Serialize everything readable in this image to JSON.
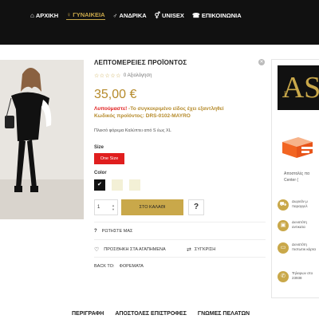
{
  "nav": {
    "items": [
      {
        "icon": "home-icon",
        "glyph": "⌂",
        "label": "ΑΡΧΙΚΗ",
        "active": false
      },
      {
        "icon": "female-icon",
        "glyph": "♀",
        "label": "ΓΥΝΑΙΚΕΙΑ",
        "active": true
      },
      {
        "icon": "male-icon",
        "glyph": "♂",
        "label": "ΑΝΔΡΙΚΑ",
        "active": false
      },
      {
        "icon": "unisex-icon",
        "glyph": "⚥",
        "label": "UNISEX",
        "active": false
      },
      {
        "icon": "contact-icon",
        "glyph": "☎",
        "label": "ΕΠΙΚΟΙΝΩΝΙΑ",
        "active": false
      }
    ]
  },
  "product": {
    "title": "ΛΕΠΤΟΜΕΡΕΙΕΣ ΠΡΟΪΟΝΤΟΣ",
    "stars": "☆☆☆☆☆",
    "rating_text": "0 Αξιολόγηση",
    "price": "35,00 €",
    "soldout_prefix": "Λυπούμαστε!",
    "soldout_text": " -Το συγκεκριμένο είδος έχει εξαντληθεί",
    "code_text": "Κωδικός προϊόντος: DRS-0102-MAYRO",
    "description": "Πλεκτό φόρεμα Καλύπτει από S έως XL",
    "size_label": "Size",
    "size_value": "One Size",
    "color_label": "Color",
    "qty_value": "1",
    "qty_up": "▲",
    "qty_down": "▼",
    "cart_label": "ΣΤΟ ΚΑΛΑΘΙ",
    "help_label": "?",
    "ask_label": "ΡΩΤΗΣΤΕ ΜΑΣ",
    "ask_glyph": "?",
    "wishlist_label": "ΠΡΟΣΘΗΚΗ ΣΤΑ ΑΓΑΠΗΜΕΝΑ",
    "wishlist_glyph": "♡",
    "compare_label": "ΣΥΓΚΡΙΣΗ",
    "compare_glyph": "⇄",
    "back_label": "BACK TO:",
    "back_link": "ΦΟΡΕΜΑΤΑ"
  },
  "tabs": [
    "ΠΕΡΙΓΡΑΦΗ",
    "ΑΠΟΣΤΟΛΕΣ ΕΠΙΣΤΡΟΦΕΣ",
    "ΓΝΩΜΕΣ ΠΕΛΑΤΩΝ"
  ],
  "sidebar": {
    "logo_letters": "AS",
    "logo_small": "F",
    "shipping_caption": "Αποστολές πα Center (",
    "rows": [
      {
        "icon": "delivery-icon",
        "glyph": "⛟",
        "text": "Δωρεάν μ παραγγελ"
      },
      {
        "icon": "cash-icon",
        "glyph": "▣",
        "text": "Δυνατότη αντικατα"
      },
      {
        "icon": "card-icon",
        "glyph": "▭",
        "text": "Δυνατότη πιστωτικ κάρτα"
      },
      {
        "icon": "phone-icon",
        "glyph": "✆",
        "text": "Τηλεφων στο 23938"
      }
    ]
  },
  "colors": {
    "accent": "#c9a84a",
    "sale_red": "#e01e1e",
    "navbar": "#111111"
  }
}
